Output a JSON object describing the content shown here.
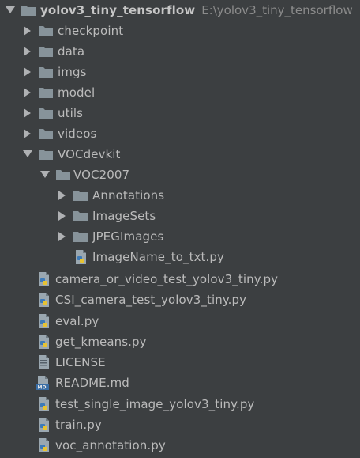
{
  "project": {
    "name": "yolov3_tiny_tensorflow",
    "path": "E:\\yolov3_tiny_tensorflow"
  },
  "folders": {
    "checkpoint": "checkpoint",
    "data": "data",
    "imgs": "imgs",
    "model": "model",
    "utils": "utils",
    "videos": "videos",
    "vocdevkit": "VOCdevkit",
    "voc2007": "VOC2007",
    "annotations": "Annotations",
    "imagesets": "ImageSets",
    "jpegimages": "JPEGImages"
  },
  "files": {
    "imagename_to_txt": "ImageName_to_txt.py",
    "camera_or_video_test": "camera_or_video_test_yolov3_tiny.py",
    "csi_camera_test": "CSI_camera_test_yolov3_tiny.py",
    "eval": "eval.py",
    "get_kmeans": "get_kmeans.py",
    "license": "LICENSE",
    "readme": "README.md",
    "test_single_image": "test_single_image_yolov3_tiny.py",
    "train": "train.py",
    "voc_annotation": "voc_annotation.py"
  },
  "colors": {
    "background": "#3c3f41",
    "text": "#bbbbbb",
    "folder": "#87939a",
    "arrow": "#afb1b3"
  }
}
